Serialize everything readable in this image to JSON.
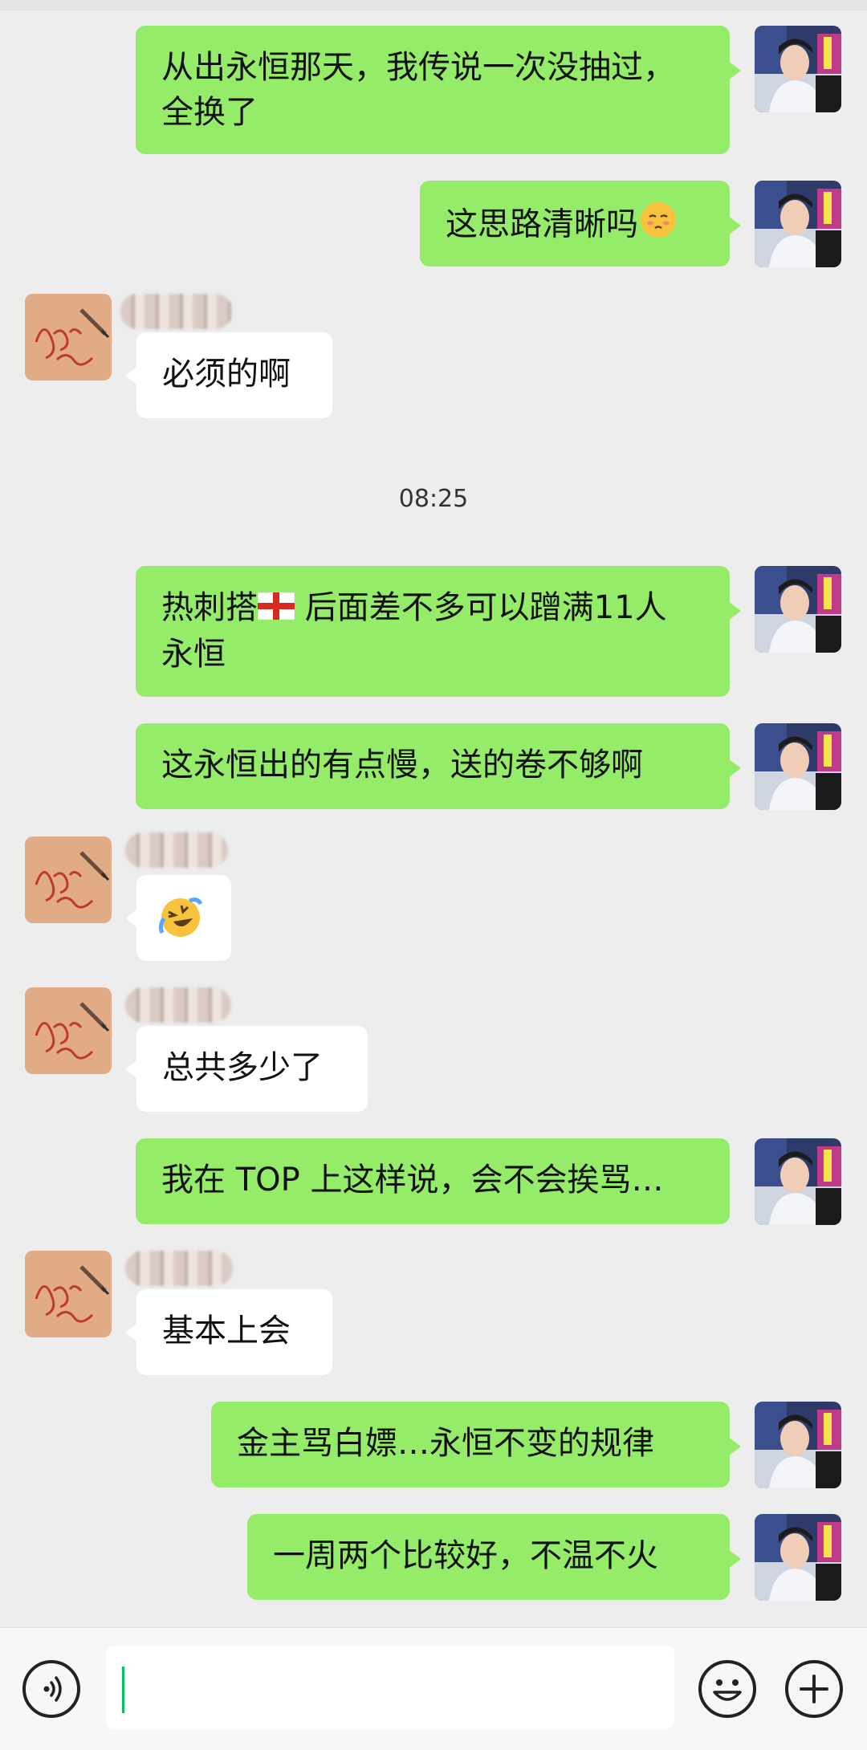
{
  "chat": {
    "timestamp": "08:25",
    "messages": [
      {
        "dir": "out",
        "text": "从出永恒那天，我传说一次没抽过，全换了"
      },
      {
        "dir": "out",
        "text": "这思路清晰吗",
        "emoji": "relieved-face"
      },
      {
        "dir": "in",
        "text": "必须的啊"
      },
      {
        "dir": "out",
        "text_before": "热刺搭",
        "flag": "england-flag",
        "text_after": " 后面差不多可以蹭满11人 永恒"
      },
      {
        "dir": "out",
        "text": "这永恒出的有点慢，送的卷不够啊"
      },
      {
        "dir": "in",
        "emoji": "rolling-on-floor-laughing"
      },
      {
        "dir": "in",
        "text": "总共多少了"
      },
      {
        "dir": "out",
        "text": "我在 TOP 上这样说，会不会挨骂…"
      },
      {
        "dir": "in",
        "text": "基本上会"
      },
      {
        "dir": "out",
        "text": "金主骂白嫖…永恒不变的规律"
      },
      {
        "dir": "out",
        "text": "一周两个比较好，不温不火"
      }
    ]
  },
  "input_bar": {
    "voice_icon": "voice-icon",
    "emoji_icon": "smiley-icon",
    "plus_icon": "plus-icon",
    "value": ""
  },
  "colors": {
    "outgoing_bubble": "#95ec69",
    "incoming_bubble": "#ffffff",
    "background": "#ededed",
    "caret": "#07c160"
  }
}
